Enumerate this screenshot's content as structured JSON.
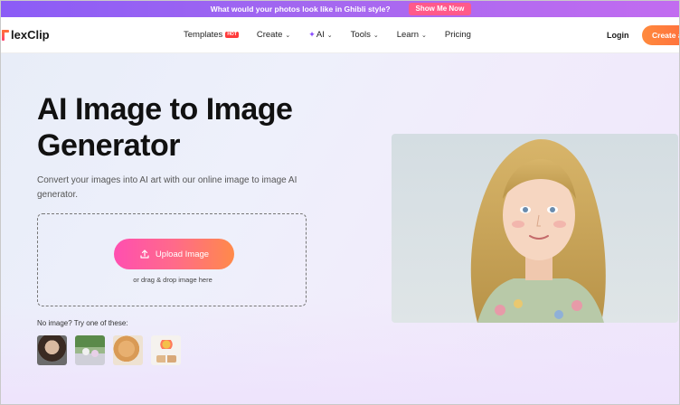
{
  "promo": {
    "text": "What would your photos look like in Ghibli style?",
    "button": "Show Me Now"
  },
  "nav": {
    "logo": "lexClip",
    "items": [
      {
        "label": "Templates",
        "badge": "HOT"
      },
      {
        "label": "Create",
        "chevron": true
      },
      {
        "label": "AI",
        "chevron": true,
        "icon": "sparkle-icon"
      },
      {
        "label": "Tools",
        "chevron": true
      },
      {
        "label": "Learn",
        "chevron": true
      },
      {
        "label": "Pricing"
      }
    ],
    "login": "Login",
    "create_button": "Create a"
  },
  "hero": {
    "title": "AI Image to Image Generator",
    "description": "Convert your images into AI art with our online image to image AI generator.",
    "upload_button": "Upload Image",
    "drop_hint": "or drag & drop image here",
    "try_label": "No image? Try one of these:",
    "samples": [
      "portrait-sample",
      "girls-garden-sample",
      "cat-sample",
      "still-life-sample"
    ]
  },
  "colors": {
    "promo_gradient_start": "#8b5cf6",
    "promo_button": "#ff5a8a",
    "create_button": "#ff8a3d",
    "upload_gradient_start": "#ff4fb0",
    "upload_gradient_end": "#ff8a4a"
  }
}
